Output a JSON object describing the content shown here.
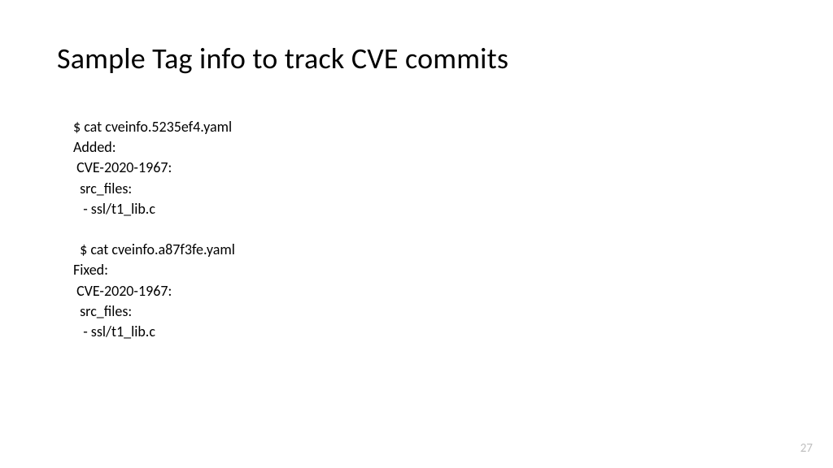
{
  "title": "Sample Tag info to track CVE commits",
  "lines": [
    "$ cat cveinfo.5235ef4.yaml",
    "Added:",
    " CVE-2020-1967:",
    "  src_files:",
    "   - ssl/t1_lib.c",
    "",
    "  $ cat cveinfo.a87f3fe.yaml",
    "Fixed:",
    " CVE-2020-1967:",
    "  src_files:",
    "   - ssl/t1_lib.c"
  ],
  "page_number": "27"
}
